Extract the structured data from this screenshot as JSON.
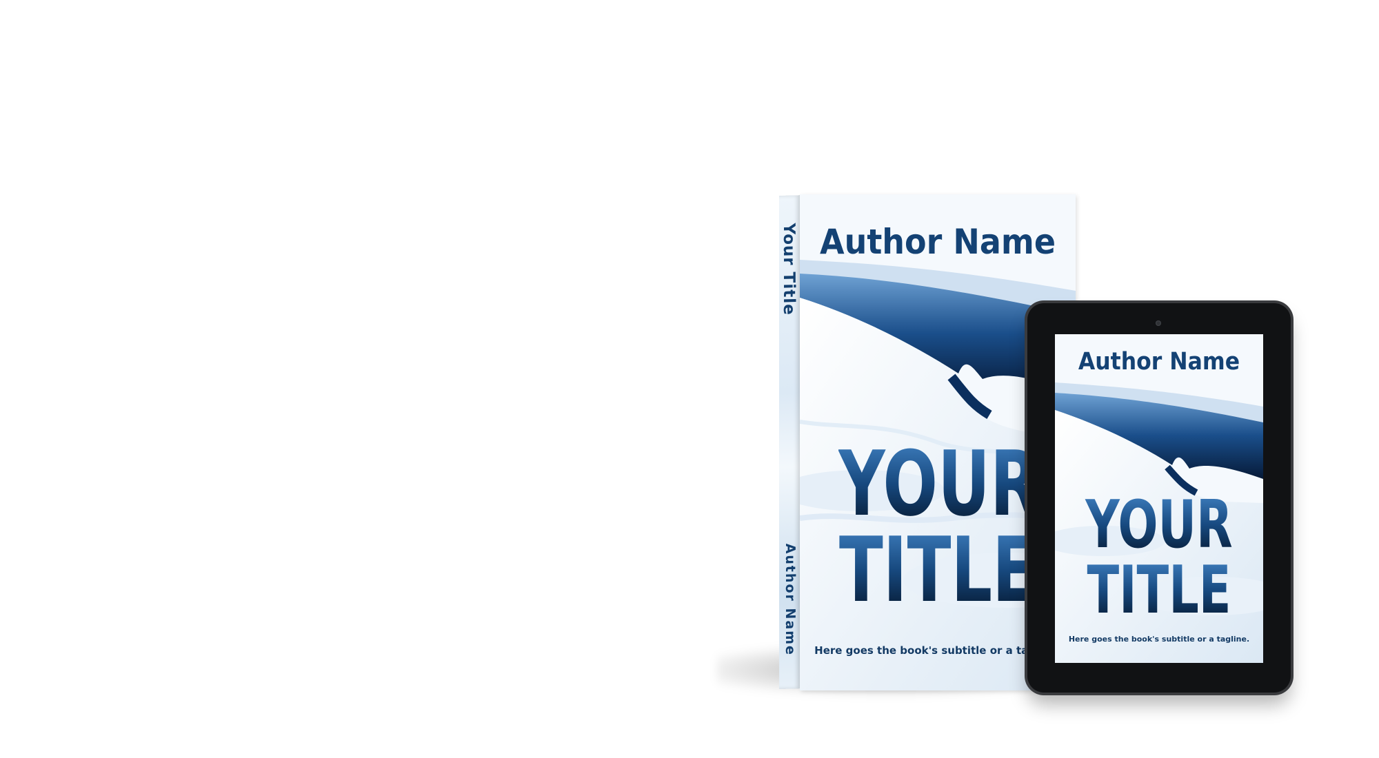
{
  "paperback": {
    "spine_title": "Your Title",
    "spine_author": "Author Name",
    "author": "Author Name",
    "title_line1": "YOUR",
    "title_line2": "TITLE",
    "subtitle": "Here goes the book's subtitle or a tagline."
  },
  "ebook": {
    "author": "Author Name",
    "title_line1": "YOUR",
    "title_line2": "TITLE",
    "subtitle": "Here goes the book's subtitle or a tagline."
  },
  "colors": {
    "title_blue": "#144274",
    "ice_deep": "#0a2a55",
    "tablet_frame": "#111214"
  }
}
